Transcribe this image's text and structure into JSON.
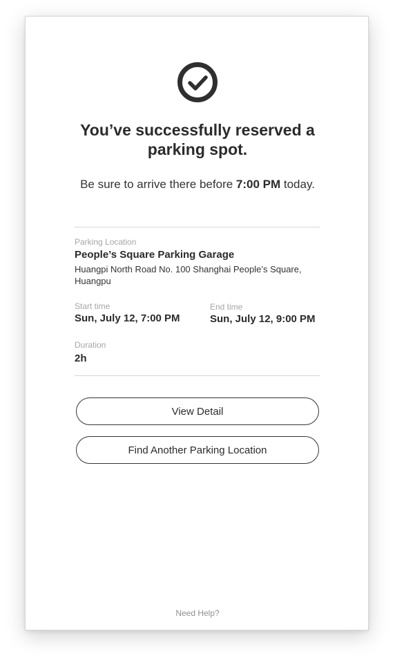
{
  "confirmation": {
    "title": "You’ve successfully reserved a parking spot.",
    "subtitle_prefix": "Be sure to arrive there before ",
    "subtitle_time": "7:00 PM",
    "subtitle_suffix": " today."
  },
  "details": {
    "location_label": "Parking Location",
    "location_name": "People’s Square Parking Garage",
    "location_address": "Huangpi North Road No. 100 Shanghai People’s Square, Huangpu",
    "start_label": "Start time",
    "start_value": "Sun, July 12, 7:00 PM",
    "end_label": "End time",
    "end_value": "Sun, July 12, 9:00 PM",
    "duration_label": "Duration",
    "duration_value": "2h"
  },
  "actions": {
    "view_detail": "View Detail",
    "find_another": "Find Another Parking Location"
  },
  "footer": {
    "help": "Need Help?"
  },
  "icons": {
    "success": "check-circle-icon"
  },
  "colors": {
    "text": "#2b2b2b",
    "muted": "#a6a6a6",
    "border": "#333333",
    "divider": "#d4d4d4"
  }
}
